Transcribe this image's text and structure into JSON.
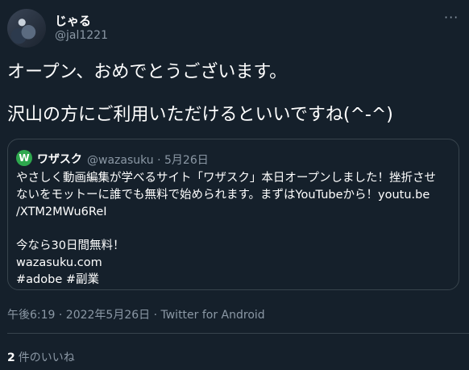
{
  "author": {
    "name": "じゃる",
    "handle": "@jal1221"
  },
  "tweet": {
    "line1": "オープン、おめでとうございます。",
    "line2": "沢山の方にご利用いただけるといいですね(^-^)"
  },
  "quote": {
    "logo_letter": "W",
    "name": "ワザスク",
    "meta": "@wazasuku · 5月26日",
    "line1": "やさしく動画編集が学べるサイト「ワザスク」本日オープンしました！挫折させ",
    "line2": "ないをモットーに誰でも無料で始められます。まずはYouTubeから！youtu.be",
    "line3": "/XTM2MWu6ReI",
    "line4": "今なら30日間無料！",
    "line5": "wazasuku.com",
    "line6": "#adobe  #副業"
  },
  "timestamp": "午後6:19 · 2022年5月26日 · Twitter for Android",
  "likes": {
    "count": "2",
    "label": "件のいいね"
  },
  "icons": {
    "more": "more-options-icon",
    "logo": "wazasuku-logo-icon"
  },
  "colors": {
    "background": "#15202b",
    "muted": "#8b98a5",
    "border": "#38444d",
    "logo": "#2ea84e"
  }
}
